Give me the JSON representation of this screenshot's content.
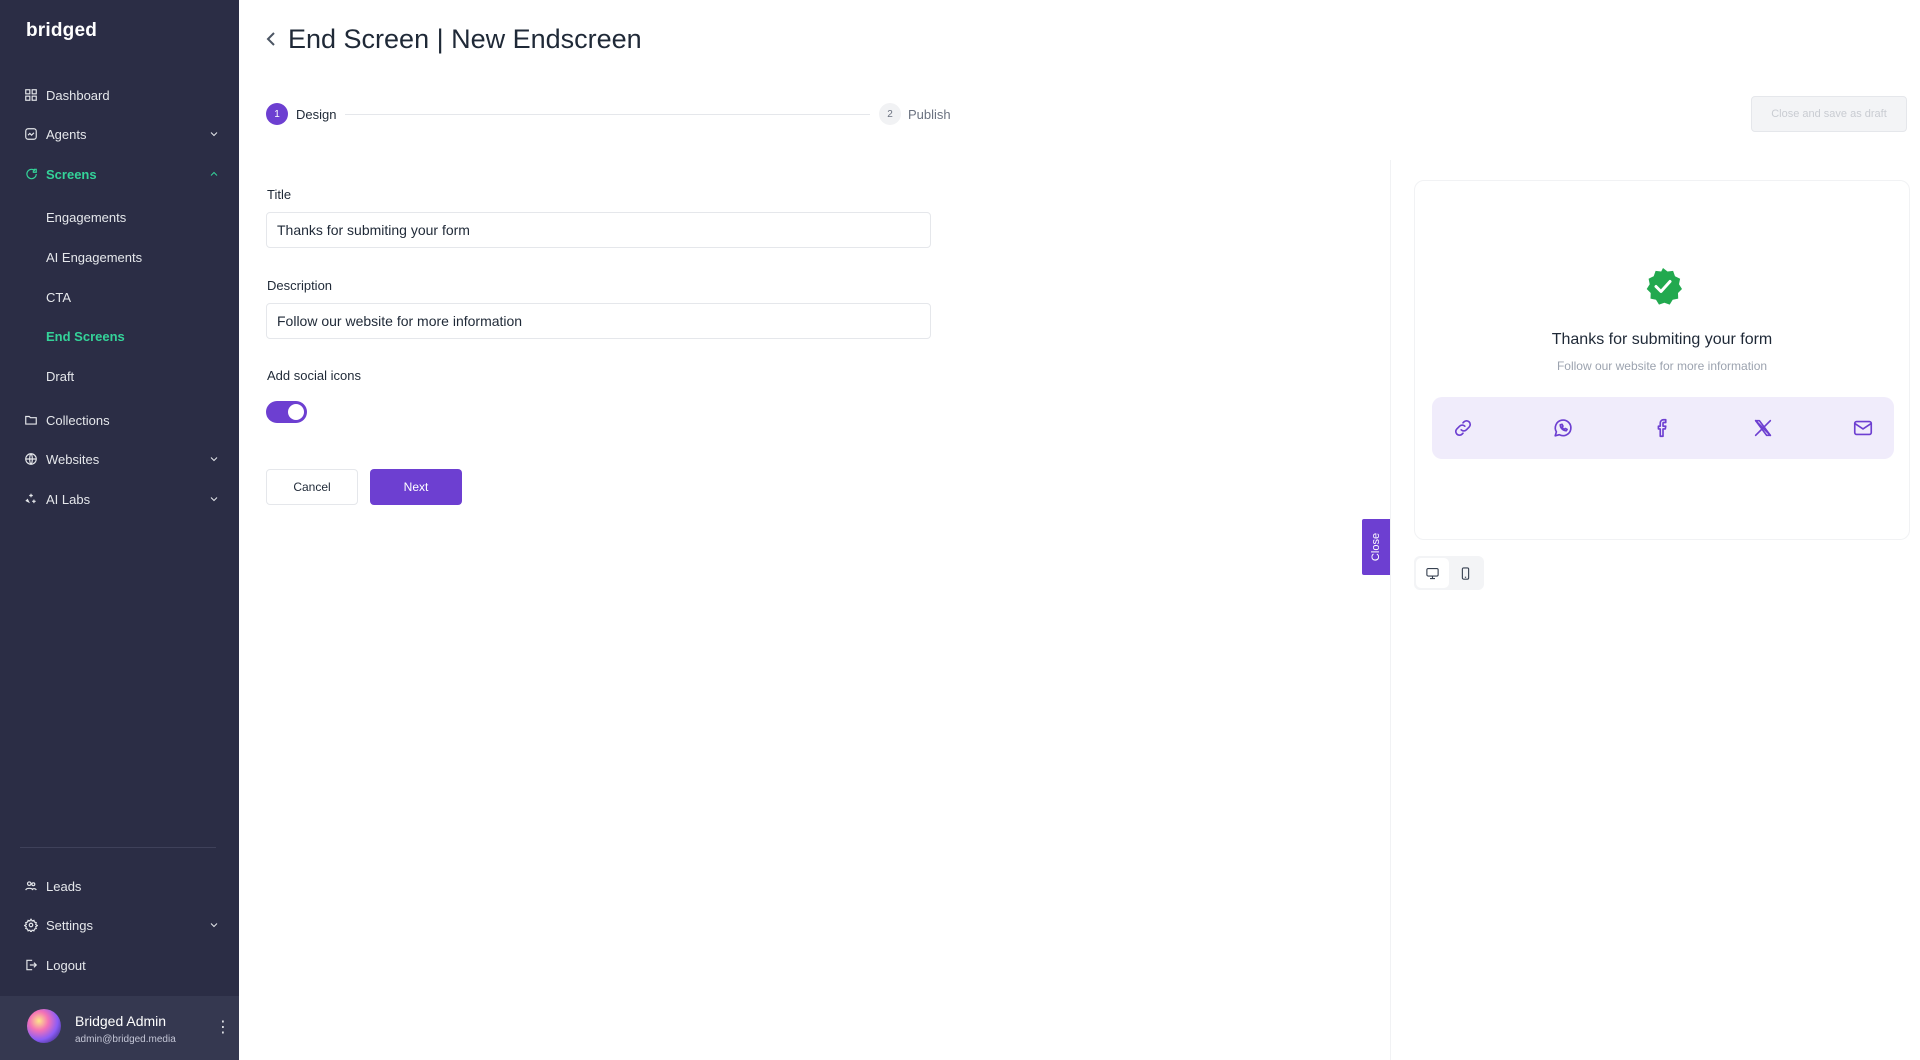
{
  "app": {
    "logo": "bridged"
  },
  "sidebar": {
    "items": [
      {
        "label": "Dashboard"
      },
      {
        "label": "Agents"
      },
      {
        "label": "Screens"
      },
      {
        "label": "Collections"
      },
      {
        "label": "Websites"
      },
      {
        "label": "AI Labs"
      }
    ],
    "screens_sub": [
      {
        "label": "Engagements"
      },
      {
        "label": "AI Engagements"
      },
      {
        "label": "CTA"
      },
      {
        "label": "End Screens"
      },
      {
        "label": "Draft"
      }
    ],
    "bottom": [
      {
        "label": "Leads"
      },
      {
        "label": "Settings"
      },
      {
        "label": "Logout"
      }
    ],
    "user": {
      "name": "Bridged Admin",
      "email": "admin@bridged.media"
    }
  },
  "header": {
    "title": "End Screen | New Endscreen"
  },
  "stepper": {
    "steps": [
      {
        "number": "1",
        "label": "Design"
      },
      {
        "number": "2",
        "label": "Publish"
      }
    ],
    "draft_label": "Close and save as draft"
  },
  "form": {
    "title_label": "Title",
    "title_value": "Thanks for submiting your form",
    "description_label": "Description",
    "description_value": "Follow our website for more information",
    "social_label": "Add social icons",
    "social_enabled": true,
    "cancel_label": "Cancel",
    "next_label": "Next"
  },
  "close_tab": "Close",
  "preview": {
    "title": "Thanks for submiting your form",
    "description": "Follow our website for more information",
    "social_icons": [
      "link-icon",
      "whatsapp-icon",
      "facebook-icon",
      "x-icon",
      "mail-icon"
    ]
  },
  "colors": {
    "accent": "#6d3fd1",
    "sidebar_bg": "#2b2d45",
    "active_nav": "#34d399",
    "success": "#22a94f"
  }
}
